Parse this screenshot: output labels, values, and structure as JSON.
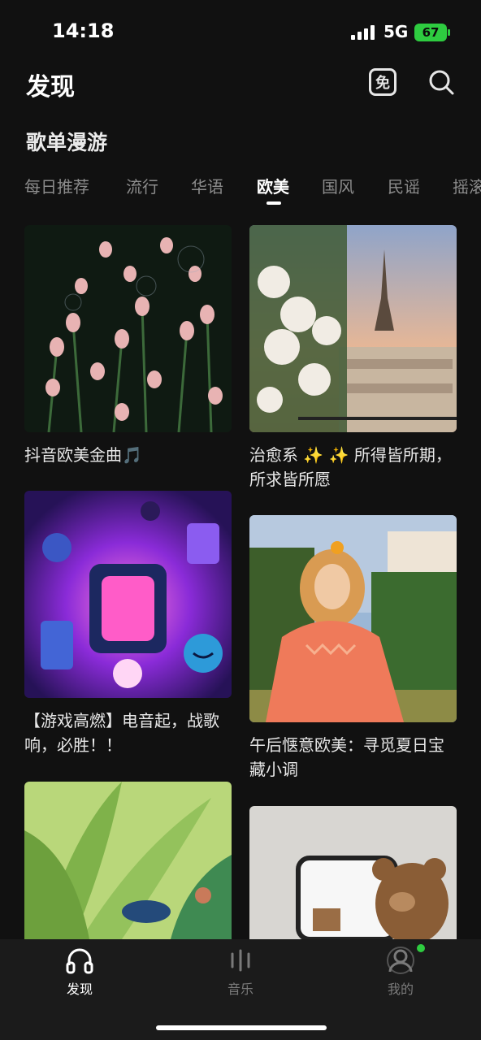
{
  "status_bar": {
    "time": "14:18",
    "network": "5G",
    "battery": "67"
  },
  "header": {
    "title": "发现",
    "free_icon_text": "免"
  },
  "section": {
    "title": "歌单漫游"
  },
  "tabs": [
    "每日推荐",
    "流行",
    "华语",
    "欧美",
    "国风",
    "民谣",
    "摇滚"
  ],
  "active_tab": "欧美",
  "playlists": [
    {
      "title": "抖音欧美金曲🎵"
    },
    {
      "title": "治愈系 ✨ ✨ 所得皆所期，所求皆所愿"
    },
    {
      "title": "【游戏高燃】电音起，战歌响，必胜！！"
    },
    {
      "title": "午后惬意欧美：寻觅夏日宝藏小调"
    },
    {
      "title": ""
    },
    {
      "title": ""
    }
  ],
  "bottom_nav": [
    {
      "label": "发现",
      "icon": "headphones-icon",
      "active": true
    },
    {
      "label": "音乐",
      "icon": "bars-icon",
      "active": false
    },
    {
      "label": "我的",
      "icon": "user-icon",
      "active": false,
      "badge": true
    }
  ],
  "colors": {
    "accent": "#2ecc40",
    "background": "#111111",
    "tab_inactive": "#8c8c8c"
  }
}
